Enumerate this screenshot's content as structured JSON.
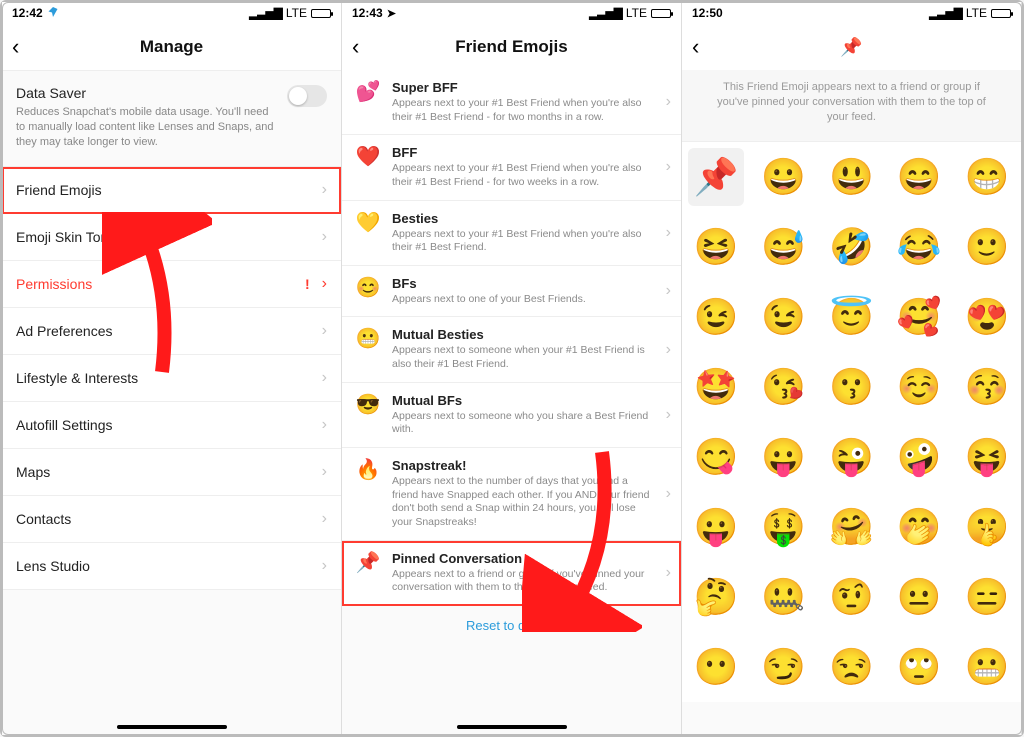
{
  "screen1": {
    "status": {
      "time": "12:42",
      "network": "LTE"
    },
    "title": "Manage",
    "dataSaver": {
      "title": "Data Saver",
      "desc": "Reduces Snapchat's mobile data usage. You'll need to manually load content like Lenses and Snaps, and they may take longer to view."
    },
    "rows": [
      {
        "label": "Friend Emojis",
        "highlight": true
      },
      {
        "label": "Emoji Skin Tone"
      },
      {
        "label": "Permissions",
        "alert": true
      },
      {
        "label": "Ad Preferences"
      },
      {
        "label": "Lifestyle & Interests"
      },
      {
        "label": "Autofill Settings"
      },
      {
        "label": "Maps"
      },
      {
        "label": "Contacts"
      },
      {
        "label": "Lens Studio"
      }
    ]
  },
  "screen2": {
    "status": {
      "time": "12:43",
      "network": "LTE"
    },
    "title": "Friend Emojis",
    "items": [
      {
        "emoji": "💕",
        "title": "Super BFF",
        "desc": "Appears next to your #1 Best Friend when you're also their #1 Best Friend - for two months in a row."
      },
      {
        "emoji": "❤️",
        "title": "BFF",
        "desc": "Appears next to your #1 Best Friend when you're also their #1 Best Friend - for two weeks in a row."
      },
      {
        "emoji": "💛",
        "title": "Besties",
        "desc": "Appears next to your #1 Best Friend when you're also their #1 Best Friend."
      },
      {
        "emoji": "😊",
        "title": "BFs",
        "desc": "Appears next to one of your Best Friends."
      },
      {
        "emoji": "😬",
        "title": "Mutual Besties",
        "desc": "Appears next to someone when your #1 Best Friend is also their #1 Best Friend."
      },
      {
        "emoji": "😎",
        "title": "Mutual BFs",
        "desc": "Appears next to someone who you share a Best Friend with."
      },
      {
        "emoji": "🔥",
        "title": "Snapstreak!",
        "desc": "Appears next to the number of days that you and a friend have Snapped each other. If you AND your friend don't both send a Snap within 24 hours, you will lose your Snapstreaks!"
      },
      {
        "emoji": "📌",
        "title": "Pinned Conversation",
        "desc": "Appears next to a friend or group if you've pinned your conversation with them to the top of your feed.",
        "highlight": true
      }
    ],
    "reset": "Reset to default"
  },
  "screen3": {
    "status": {
      "time": "12:50",
      "network": "LTE"
    },
    "titleEmoji": "📌",
    "desc": "This Friend Emoji appears next to a friend or group if you've pinned your conversation with them to the top of your feed.",
    "grid": [
      "📌",
      "😀",
      "😃",
      "😄",
      "😁",
      "😆",
      "😅",
      "🤣",
      "😂",
      "🙂",
      "😉",
      "😉",
      "😇",
      "🥰",
      "😍",
      "🤩",
      "😘",
      "😗",
      "☺️",
      "😚",
      "😋",
      "😛",
      "😜",
      "🤪",
      "😝",
      "😛",
      "🤑",
      "🤗",
      "🤭",
      "🤫",
      "🤔",
      "🤐",
      "🤨",
      "😐",
      "😑",
      "😶",
      "😏",
      "😒",
      "🙄",
      "😬"
    ]
  }
}
